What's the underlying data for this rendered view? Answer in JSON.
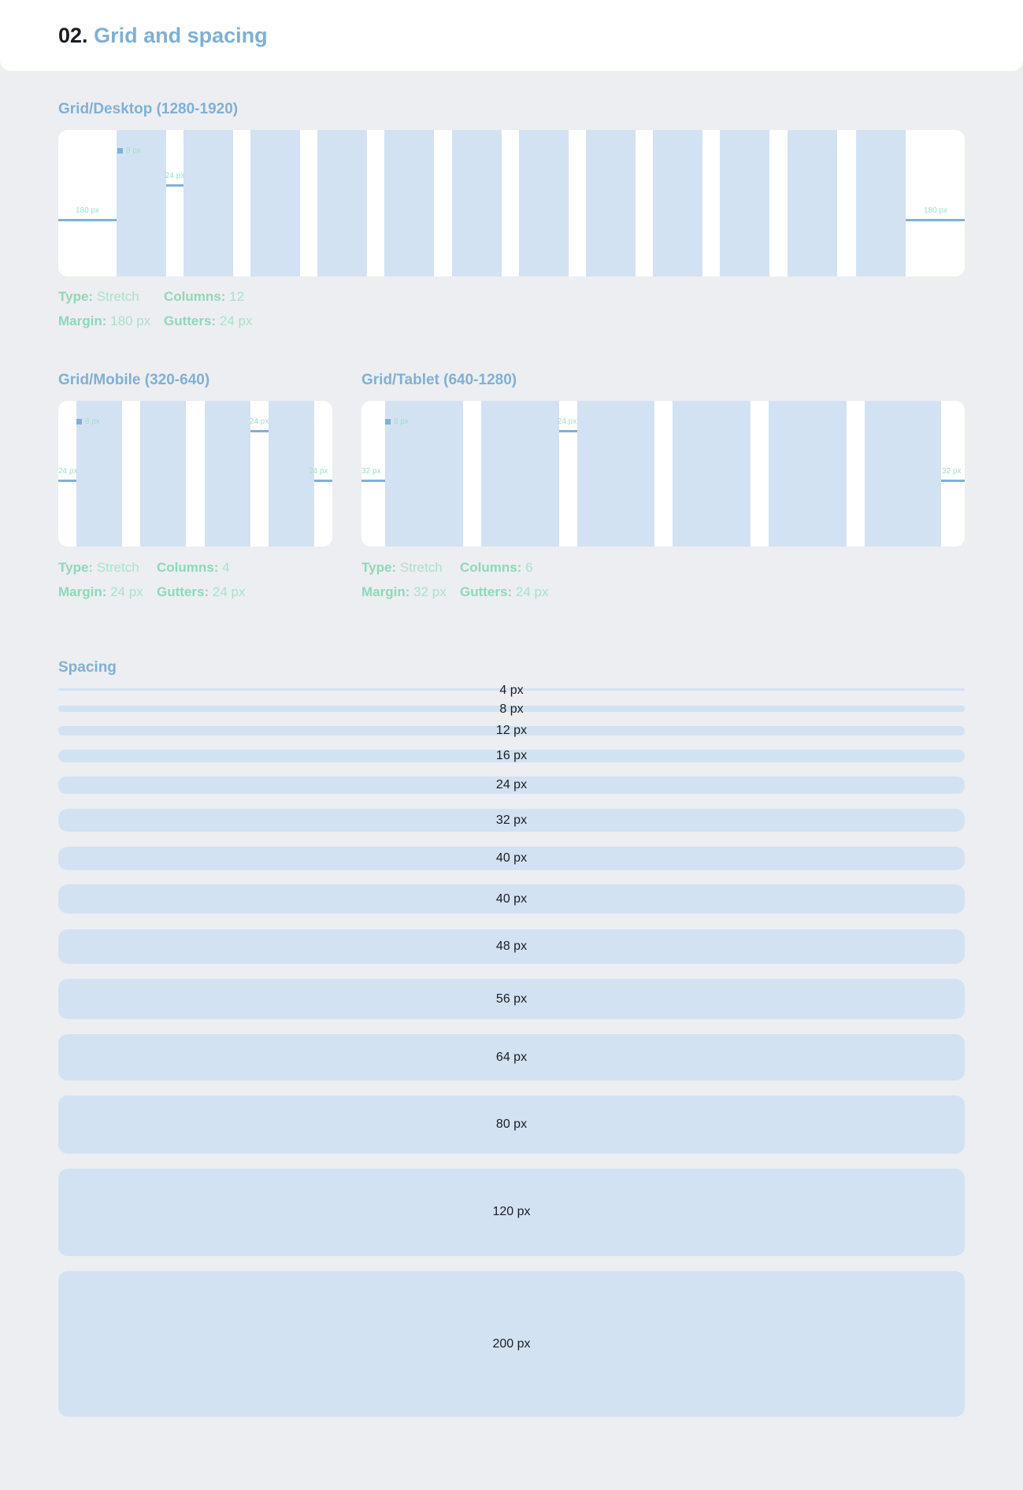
{
  "header": {
    "number": "02.",
    "title": "Grid and spacing"
  },
  "grids": {
    "desktop": {
      "title": "Grid/Desktop (1280-1920)",
      "annotations": {
        "column_label": "8 px",
        "gutter_label": "24 px",
        "margin_left": "180 px",
        "margin_right": "180 px"
      },
      "info": {
        "type_label": "Type:",
        "type_value": "Stretch",
        "columns_label": "Columns:",
        "columns_value": "12",
        "margin_label": "Margin:",
        "margin_value": "180 px",
        "gutters_label": "Gutters:",
        "gutters_value": "24 px"
      }
    },
    "mobile": {
      "title": "Grid/Mobile (320-640)",
      "annotations": {
        "column_label": "8 px",
        "gutter_label": "24 px",
        "margin_left": "24 px",
        "margin_right": "24 px"
      },
      "info": {
        "type_label": "Type:",
        "type_value": "Stretch",
        "columns_label": "Columns:",
        "columns_value": "4",
        "margin_label": "Margin:",
        "margin_value": "24 px",
        "gutters_label": "Gutters:",
        "gutters_value": "24 px"
      }
    },
    "tablet": {
      "title": "Grid/Tablet (640-1280)",
      "annotations": {
        "column_label": "8 px",
        "gutter_label": "24 px",
        "margin_left": "32 px",
        "margin_right": "32 px"
      },
      "info": {
        "type_label": "Type:",
        "type_value": "Stretch",
        "columns_label": "Columns:",
        "columns_value": "6",
        "margin_label": "Margin:",
        "margin_value": "32 px",
        "gutters_label": "Gutters:",
        "gutters_value": "24 px"
      }
    }
  },
  "spacing": {
    "title": "Spacing",
    "items": [
      "4 px",
      "8 px",
      "12 px",
      "16 px",
      "24 px",
      "32 px",
      "40 px",
      "40 px",
      "48 px",
      "56 px",
      "64 px",
      "80 px",
      "120 px",
      "200 px"
    ]
  },
  "colors": {
    "accent_blue": "#7fb0d6",
    "column_fill": "#d3e2f2",
    "annotation_green": "#9ee0c6",
    "background": "#eceef1"
  }
}
